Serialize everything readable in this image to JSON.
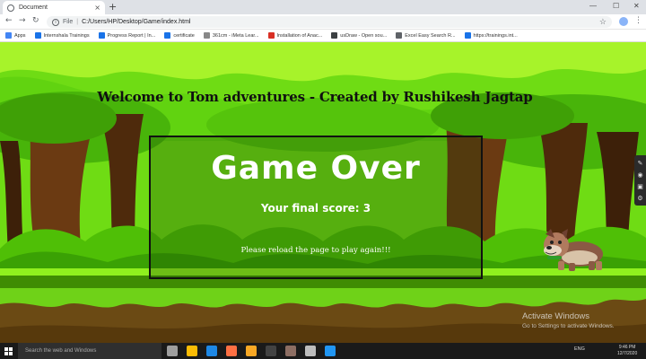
{
  "browser": {
    "tab_title": "Document",
    "url_scheme_label": "File",
    "url": "C:/Users/HP/Desktop/Game/index.html",
    "bookmarks": [
      {
        "label": "Apps",
        "color": "#4285f4"
      },
      {
        "label": "Internshala Trainings",
        "color": "#1a73e8"
      },
      {
        "label": "Progress Report | In...",
        "color": "#1a73e8"
      },
      {
        "label": "certificate",
        "color": "#1a73e8"
      },
      {
        "label": "361cm - iMeta Lear...",
        "color": "#888888"
      },
      {
        "label": "Installation of Anac...",
        "color": "#d93025"
      },
      {
        "label": "usDraw - Open sou...",
        "color": "#3c4043"
      },
      {
        "label": "Excel Easy Search R...",
        "color": "#5f6368"
      },
      {
        "label": "https://trainings.int...",
        "color": "#1a73e8"
      }
    ]
  },
  "game": {
    "welcome_text": "Welcome to Tom adventures - Created by Rushikesh Jagtap",
    "game_over_title": "Game Over",
    "final_score_text": "Your final score: 3",
    "reload_text": "Please reload the page to play again!!!"
  },
  "windows": {
    "activate_title": "Activate Windows",
    "activate_sub": "Go to Settings to activate Windows.",
    "search_placeholder": "Search the web and Windows",
    "tray_lang": "ENG",
    "time": "9:46 PM",
    "date": "12/7/2020",
    "taskbar_icons": [
      {
        "name": "task-view-icon",
        "color": "#9e9e9e"
      },
      {
        "name": "chrome-icon",
        "color": "#fbbc05"
      },
      {
        "name": "edge-icon",
        "color": "#1e88e5"
      },
      {
        "name": "firefox-icon",
        "color": "#ff7043"
      },
      {
        "name": "explorer-icon",
        "color": "#f9a825"
      },
      {
        "name": "terminal-icon",
        "color": "#424242"
      },
      {
        "name": "app-icon",
        "color": "#8d6e63"
      },
      {
        "name": "app2-icon",
        "color": "#bdbdbd"
      },
      {
        "name": "vscode-icon",
        "color": "#2196f3"
      }
    ]
  },
  "colors": {
    "sky": "#6fdc14",
    "canopy_light": "#9bf022",
    "trunk": "#6b3a12",
    "bush": "#4fbf06",
    "ground": "#3f8c03",
    "soil": "#6b4a14"
  }
}
